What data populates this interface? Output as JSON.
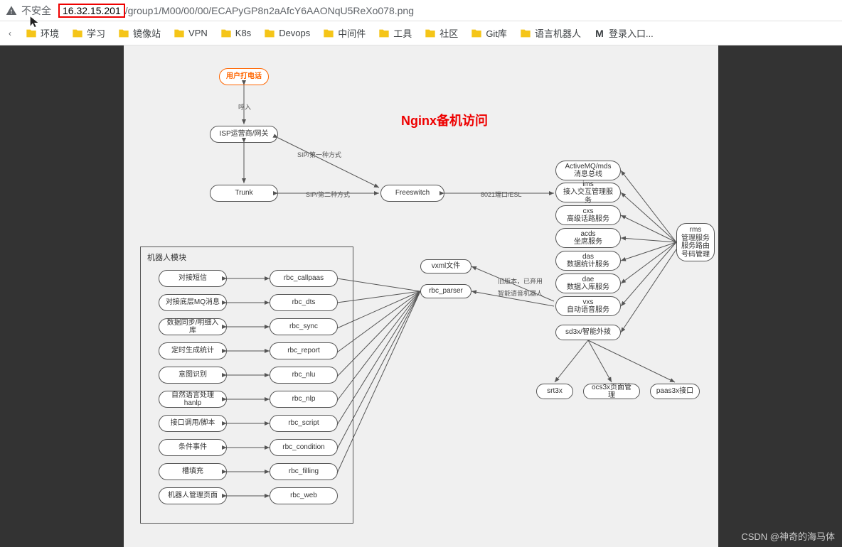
{
  "browser": {
    "security": "不安全",
    "highlighted_ip": "16.32.15.201",
    "url_path": "/group1/M00/00/00/ECAPyGP8n2aAfcY6AAONqU5ReXo078.png"
  },
  "bookmarks": {
    "lead_char": "‹",
    "items": [
      {
        "label": "环境",
        "type": "folder"
      },
      {
        "label": "学习",
        "type": "folder"
      },
      {
        "label": "镜像站",
        "type": "folder"
      },
      {
        "label": "VPN",
        "type": "folder"
      },
      {
        "label": "K8s",
        "type": "folder"
      },
      {
        "label": "Devops",
        "type": "folder"
      },
      {
        "label": "中间件",
        "type": "folder"
      },
      {
        "label": "工具",
        "type": "folder"
      },
      {
        "label": "社区",
        "type": "folder"
      },
      {
        "label": "Git库",
        "type": "folder"
      },
      {
        "label": "语言机器人",
        "type": "folder"
      },
      {
        "label": "登录入口...",
        "type": "m"
      }
    ]
  },
  "diagram": {
    "title": "Nginx备机访问",
    "robot_module_title": "机器人模块",
    "nodes": {
      "user_call": "用户打电话",
      "isp": "ISP运营商/网关",
      "trunk": "Trunk",
      "freeswitch": "Freeswitch",
      "activemq": "ActiveMQ/mds\n消息总线",
      "ims": "ims\n接入交互管理服务",
      "cxs": "cxs\n高级话路服务",
      "acds": "acds\n坐席服务",
      "das": "das\n数据统计服务",
      "dae": "dae\n数据入库服务",
      "vxs": "vxs\n自动语音服务",
      "sd3x": "sd3x/智能外拨",
      "rms": "rms\n管理服务\n服务路由\n号码管理",
      "srt3x": "srt3x",
      "ocs3x": "ocs3x页面管理",
      "paas3x": "paas3x接口",
      "vxml": "vxml文件",
      "rbc_parser": "rbc_parser",
      "robot_left": [
        "对接短信",
        "对接底层MQ消息",
        "数据同步/明细入库",
        "定时生成统计",
        "意图识别",
        "自然语言处理hanlp",
        "接口调用/脚本",
        "条件事件",
        "槽填充",
        "机器人管理页面"
      ],
      "robot_right": [
        "rbc_callpaas",
        "rbc_dts",
        "rbc_sync",
        "rbc_report",
        "rbc_nlu",
        "rbc_nlp",
        "rbc_script",
        "rbc_condition",
        "rbc_filling",
        "rbc_web"
      ]
    },
    "edge_labels": {
      "call_in": "呼入",
      "sip1": "SIP/第一种方式",
      "sip2": "SIP/第二种方式",
      "esl": "8021端口/ESL",
      "old_ver": "旧版本，已弃用",
      "smart_bot": "智能语音机器人"
    }
  },
  "watermark": "CSDN @神奇的海马体"
}
